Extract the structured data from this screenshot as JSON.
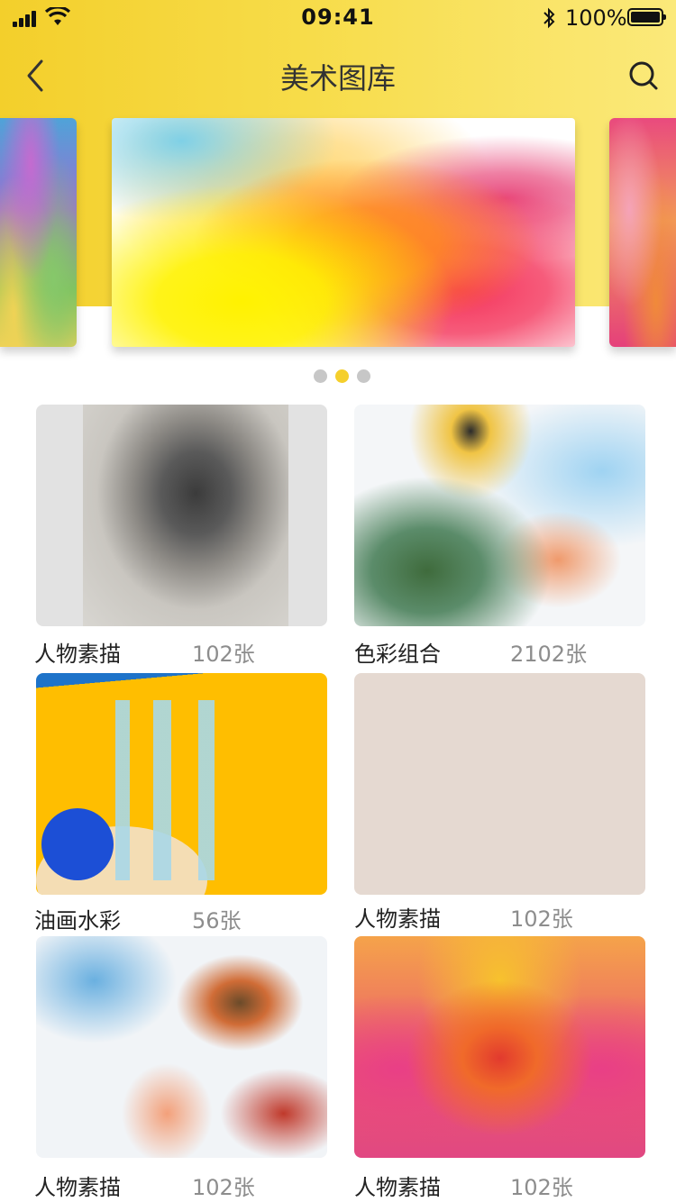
{
  "status_bar": {
    "time": "09:41",
    "battery_percent": "100%"
  },
  "nav": {
    "title": "美术图库",
    "back_icon": "chevron-left-icon",
    "search_icon": "search-icon"
  },
  "colors": {
    "header_yellow": "#f5d537",
    "active_dot": "#f5cf2c",
    "inactive_dot": "#c7c7c7"
  },
  "carousel": {
    "dot_count": 3,
    "active_index": 1
  },
  "cards": [
    {
      "name": "人物素描",
      "count": "102张"
    },
    {
      "name": "色彩组合",
      "count": "2102张"
    },
    {
      "name": "油画水彩",
      "count": "56张"
    },
    {
      "name": "人物素描",
      "count": "102张"
    },
    {
      "name": "人物素描",
      "count": "102张"
    },
    {
      "name": "人物素描",
      "count": "102张"
    }
  ]
}
